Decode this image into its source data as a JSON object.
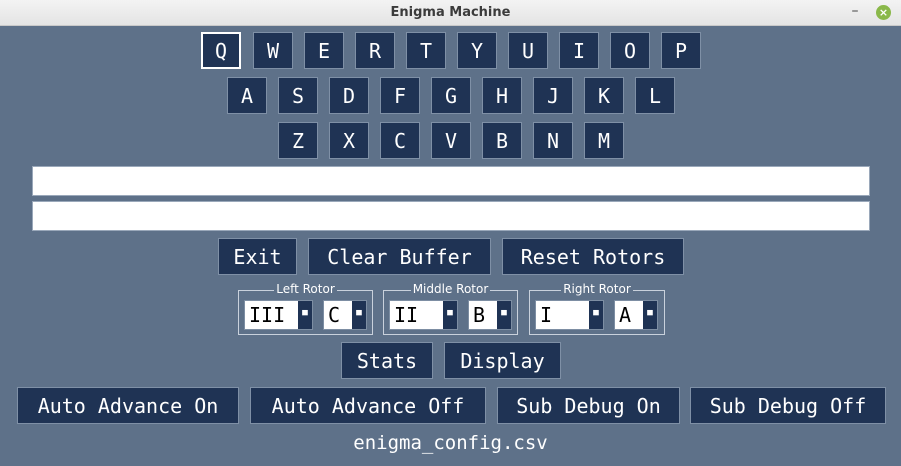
{
  "window": {
    "title": "Enigma Machine"
  },
  "keyboard": {
    "row1": [
      "Q",
      "W",
      "E",
      "R",
      "T",
      "Y",
      "U",
      "I",
      "O",
      "P"
    ],
    "row2": [
      "A",
      "S",
      "D",
      "F",
      "G",
      "H",
      "J",
      "K",
      "L"
    ],
    "row3": [
      "Z",
      "X",
      "C",
      "V",
      "B",
      "N",
      "M"
    ]
  },
  "fields": {
    "input": "",
    "output": ""
  },
  "controls": {
    "exit": "Exit",
    "clear_buffer": "Clear Buffer",
    "reset_rotors": "Reset Rotors",
    "stats": "Stats",
    "display": "Display",
    "auto_advance_on": "Auto Advance On",
    "auto_advance_off": "Auto Advance Off",
    "sub_debug_on": "Sub Debug On",
    "sub_debug_off": "Sub Debug Off"
  },
  "rotors": {
    "left": {
      "label": "Left Rotor",
      "rotor": "III",
      "position": "C"
    },
    "middle": {
      "label": "Middle Rotor",
      "rotor": "II",
      "position": "B"
    },
    "right": {
      "label": "Right Rotor",
      "rotor": "I",
      "position": "A"
    }
  },
  "status": {
    "config_file": "enigma_config.csv"
  }
}
